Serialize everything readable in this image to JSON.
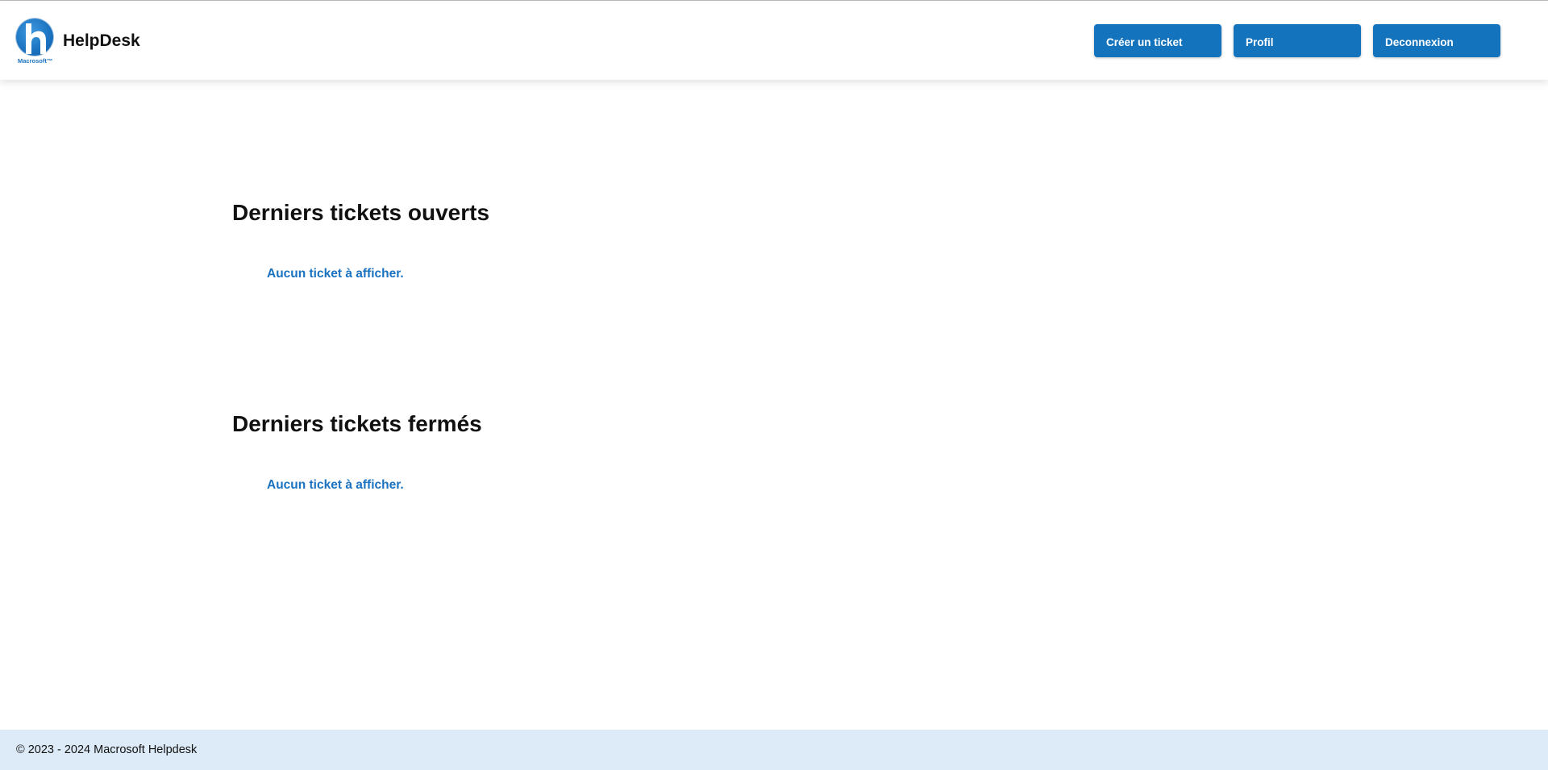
{
  "header": {
    "logo_caption": "Macrosoft™",
    "brand_title": "HelpDesk",
    "nav": {
      "create_ticket": "Créer un ticket",
      "profile": "Profil",
      "logout": "Deconnexion"
    }
  },
  "sections": {
    "open": {
      "title": "Derniers tickets ouverts",
      "empty_message": "Aucun ticket à afficher."
    },
    "closed": {
      "title": "Derniers tickets fermés",
      "empty_message": "Aucun ticket à afficher."
    }
  },
  "footer": {
    "text": "© 2023 - 2024 Macrosoft Helpdesk"
  },
  "colors": {
    "accent": "#1473bd",
    "link": "#1a72c0",
    "footer_bg": "#dcebf7"
  }
}
